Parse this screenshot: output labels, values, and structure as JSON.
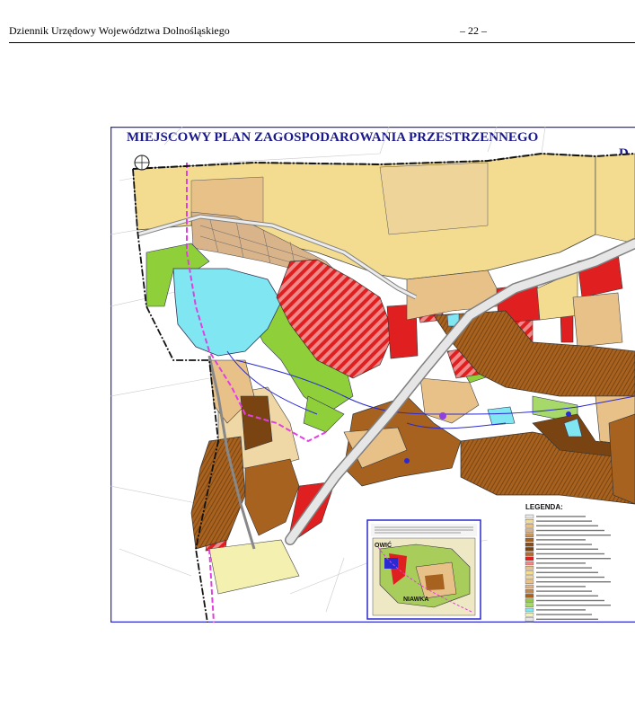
{
  "header": {
    "journal_title": "Dziennik Urzędowy Województwa Dolnośląskiego",
    "page_number": "– 22 –"
  },
  "map": {
    "title_line1": "MIEJSCOWY PLAN ZAGOSPODAROWANIA PRZESTRZENNEGO",
    "title_line2": "D",
    "legend_title": "LEGENDA:",
    "inset_place_1": "OWIĆ",
    "inset_place_2": "NIAWKA",
    "colors": {
      "frame": "#2a2ad0",
      "residential_yellow": "#f3dc90",
      "residential_tan": "#e8c189",
      "brown": "#a8621f",
      "dark_brown": "#7a4412",
      "red": "#e02020",
      "water": "#7fe6f2",
      "green": "#8fcf3a",
      "road": "#d8d8d8",
      "boundary": "#e040e0"
    }
  }
}
